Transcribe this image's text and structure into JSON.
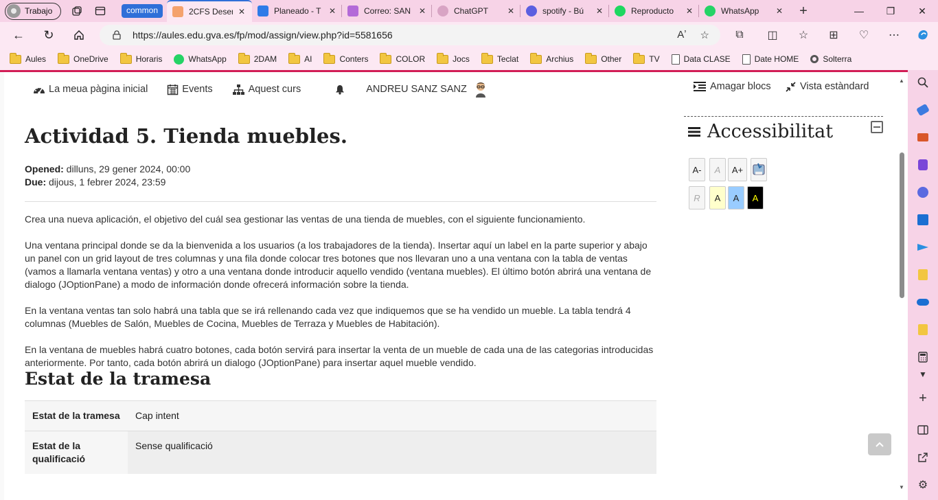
{
  "browser": {
    "profile_label": "Trabajo",
    "group_label": "common",
    "tabs": [
      {
        "title": "2CFS Desen",
        "color": "#f4a26d",
        "active": true
      },
      {
        "title": "Planeado - T",
        "color": "#2e7be8"
      },
      {
        "title": "Correo: SAN",
        "color": "#b36ad8"
      },
      {
        "title": "ChatGPT",
        "color": "#d8a4c4"
      },
      {
        "title": "spotify - Bú",
        "color": "#5b5fe0"
      },
      {
        "title": "Reproducto",
        "color": "#1ed760"
      },
      {
        "title": "WhatsApp",
        "color": "#25d366"
      }
    ],
    "url": "https://aules.edu.gva.es/fp/mod/assign/view.php?id=5581656",
    "bookmarks": [
      {
        "label": "Aules",
        "type": "folder"
      },
      {
        "label": "OneDrive",
        "type": "folder"
      },
      {
        "label": "Horaris",
        "type": "folder"
      },
      {
        "label": "WhatsApp",
        "type": "whatsapp"
      },
      {
        "label": "2DAM",
        "type": "folder"
      },
      {
        "label": "AI",
        "type": "folder"
      },
      {
        "label": "Conters",
        "type": "folder"
      },
      {
        "label": "COLOR",
        "type": "folder"
      },
      {
        "label": "Jocs",
        "type": "folder"
      },
      {
        "label": "Teclat",
        "type": "folder"
      },
      {
        "label": "Archius",
        "type": "folder"
      },
      {
        "label": "Other",
        "type": "folder"
      },
      {
        "label": "TV",
        "type": "folder"
      },
      {
        "label": "Data CLASE",
        "type": "page"
      },
      {
        "label": "Date HOME",
        "type": "page"
      },
      {
        "label": "Solterra",
        "type": "circle"
      }
    ]
  },
  "topmenu": {
    "home": "La meua pàgina inicial",
    "events": "Events",
    "course": "Aquest curs",
    "user": "ANDREU SANZ SANZ",
    "hide_blocks": "Amagar blocs",
    "standard_view": "Vista estàndard"
  },
  "assignment": {
    "title": "Actividad 5. Tienda muebles.",
    "opened_label": "Opened:",
    "opened_value": "dilluns, 29 gener 2024, 00:00",
    "due_label": "Due:",
    "due_value": "dijous, 1 febrer 2024, 23:59",
    "paragraphs": [
      "Crea una nueva aplicación, el objetivo del cuál sea gestionar las ventas de una tienda de muebles, con el siguiente funcionamiento.",
      "Una ventana principal donde se da la bienvenida a los usuarios (a los trabajadores de la tienda). Insertar aquí un label en la parte superior y abajo un panel con un grid layout de tres columnas y una fila donde colocar tres botones que nos llevaran uno a una ventana con la tabla de ventas (vamos a llamarla ventana ventas) y otro a una ventana donde introducir aquello vendido (ventana muebles). El último botón abrirá una ventana de dialogo (JOptionPane) a modo de información donde ofrecerá información sobre la tienda.",
      "En la ventana ventas tan solo habrá una tabla que se irá rellenando cada vez que indiquemos que se ha vendido un mueble. La tabla tendrá 4 columnas (Muebles de Salón, Muebles de Cocina, Muebles de Terraza y Muebles de Habitación).",
      "En la ventana de muebles habrá cuatro botones, cada botón servirá para insertar la venta de un mueble de cada una de las categorias introducidas anteriormente. Por tanto, cada botón abrirá un dialogo (JOptionPane) para insertar aquel mueble vendido."
    ]
  },
  "status": {
    "heading": "Estat de la tramesa",
    "rows": [
      {
        "label": "Estat de la tramesa",
        "value": "Cap intent"
      },
      {
        "label": "Estat de la qualificació",
        "value": "Sense qualificació"
      }
    ]
  },
  "accessibility": {
    "title": "Accessibilitat",
    "font_buttons": [
      "A-",
      "A",
      "A+"
    ],
    "color_buttons": [
      {
        "label": "R",
        "bg": "#f5f5f5",
        "fg": "#aaaaaa"
      },
      {
        "label": "A",
        "bg": "#ffffcc",
        "fg": "#222222"
      },
      {
        "label": "A",
        "bg": "#99ccff",
        "fg": "#222222"
      },
      {
        "label": "A",
        "bg": "#000000",
        "fg": "#ffff00"
      }
    ]
  },
  "colors": {
    "accent_pink": "#d21d56",
    "browser_chrome": "#f7d3e7",
    "tab_group_blue": "#2f6fd8"
  }
}
